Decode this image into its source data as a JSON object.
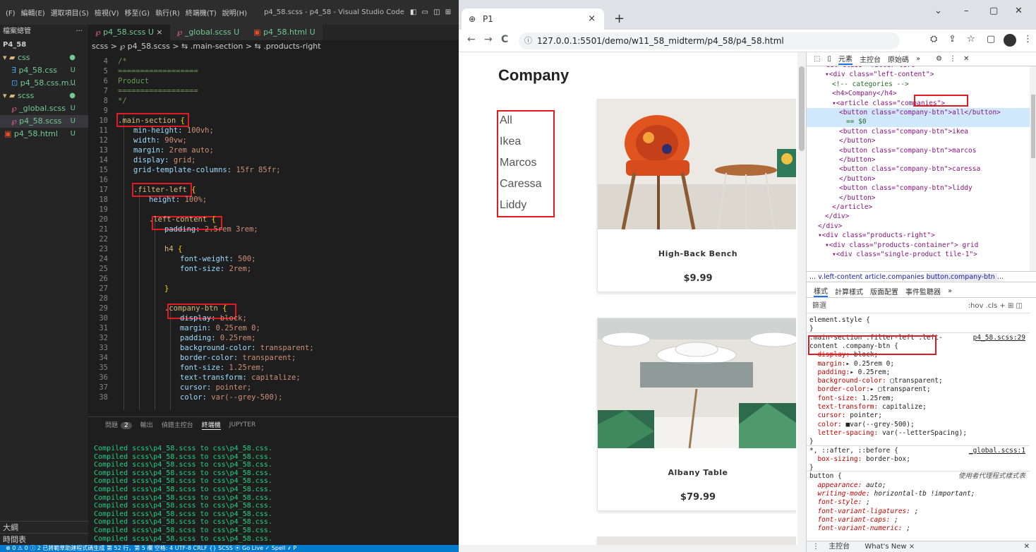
{
  "vscode": {
    "menu": [
      "(F)",
      "編輯(E)",
      "選取項目(S)",
      "檢視(V)",
      "移至(G)",
      "執行(R)",
      "終端機(T)",
      "說明(H)"
    ],
    "title": "p4_58.scss - p4_58 - Visual Studio Code",
    "layout_icons": "◧ ▭ ◫ ⊞",
    "explorer": {
      "header": "檔案總管",
      "dots": "···",
      "root": "P4_58",
      "items": [
        {
          "label": "css",
          "kind": "folder",
          "status": "●"
        },
        {
          "label": "p4_58.css",
          "kind": "css",
          "status": "U"
        },
        {
          "label": "p4_58.css.m...",
          "kind": "map",
          "status": "U"
        },
        {
          "label": "scss",
          "kind": "folder",
          "status": "●"
        },
        {
          "label": "_global.scss",
          "kind": "scss",
          "status": "U"
        },
        {
          "label": "p4_58.scss",
          "kind": "scss",
          "status": "U"
        },
        {
          "label": "p4_58.html",
          "kind": "html",
          "status": "U"
        }
      ],
      "outline": "大綱",
      "timeline": "時間表"
    },
    "tabs": [
      {
        "label": "p4_58.scss U",
        "close": "×"
      },
      {
        "label": "_global.scss U",
        "close": ""
      },
      {
        "label": "p4_58.html U",
        "close": ""
      }
    ],
    "breadcrumb": "scss > ℘ p4_58.scss > ⇆ .main-section > ⇆ .products-right",
    "code_lines": [
      {
        "n": "4",
        "t": "/*",
        "c": "cmt",
        "indent": 1
      },
      {
        "n": "5",
        "t": "==================",
        "c": "cmt",
        "indent": 1
      },
      {
        "n": "6",
        "t": "Product",
        "c": "cmt",
        "indent": 1
      },
      {
        "n": "7",
        "t": "==================",
        "c": "cmt",
        "indent": 1
      },
      {
        "n": "8",
        "t": "*/",
        "c": "cmt",
        "indent": 1
      },
      {
        "n": "9",
        "t": "",
        "c": "",
        "indent": 0
      },
      {
        "n": "10",
        "t": ".main-section {",
        "c": "sel",
        "indent": 1
      },
      {
        "n": "11",
        "t": "min-height: 100vh;",
        "c": "prop",
        "indent": 2
      },
      {
        "n": "12",
        "t": "width: 90vw;",
        "c": "prop",
        "indent": 2
      },
      {
        "n": "13",
        "t": "margin: 2rem auto;",
        "c": "prop",
        "indent": 2
      },
      {
        "n": "14",
        "t": "display: grid;",
        "c": "prop",
        "indent": 2
      },
      {
        "n": "15",
        "t": "grid-template-columns: 15fr 85fr;",
        "c": "prop",
        "indent": 2
      },
      {
        "n": "16",
        "t": "",
        "c": "",
        "indent": 0
      },
      {
        "n": "17",
        "t": ".filter-left {",
        "c": "sel",
        "indent": 2
      },
      {
        "n": "18",
        "t": "height: 100%;",
        "c": "prop",
        "indent": 3
      },
      {
        "n": "19",
        "t": "",
        "c": "",
        "indent": 0
      },
      {
        "n": "20",
        "t": ".left-content {",
        "c": "sel",
        "indent": 3
      },
      {
        "n": "21",
        "t": "padding: 2.5rem 3rem;",
        "c": "prop",
        "indent": 4
      },
      {
        "n": "22",
        "t": "",
        "c": "",
        "indent": 0
      },
      {
        "n": "23",
        "t": "h4 {",
        "c": "sel",
        "indent": 4
      },
      {
        "n": "24",
        "t": "font-weight: 500;",
        "c": "prop",
        "indent": 5
      },
      {
        "n": "25",
        "t": "font-size: 2rem;",
        "c": "prop",
        "indent": 5
      },
      {
        "n": "26",
        "t": "",
        "c": "",
        "indent": 0
      },
      {
        "n": "27",
        "t": "}",
        "c": "brc",
        "indent": 4
      },
      {
        "n": "28",
        "t": "",
        "c": "",
        "indent": 0
      },
      {
        "n": "29",
        "t": ".company-btn {",
        "c": "sel",
        "indent": 4
      },
      {
        "n": "30",
        "t": "display: block;",
        "c": "prop",
        "indent": 5
      },
      {
        "n": "31",
        "t": "margin: 0.25rem 0;",
        "c": "prop",
        "indent": 5
      },
      {
        "n": "32",
        "t": "padding: 0.25rem;",
        "c": "prop",
        "indent": 5
      },
      {
        "n": "33",
        "t": "background-color: transparent;",
        "c": "prop",
        "indent": 5
      },
      {
        "n": "34",
        "t": "border-color: transparent;",
        "c": "prop",
        "indent": 5
      },
      {
        "n": "35",
        "t": "font-size: 1.25rem;",
        "c": "prop",
        "indent": 5
      },
      {
        "n": "36",
        "t": "text-transform: capitalize;",
        "c": "prop",
        "indent": 5
      },
      {
        "n": "37",
        "t": "cursor: pointer;",
        "c": "prop",
        "indent": 5
      },
      {
        "n": "38",
        "t": "color: var(--grey-500);",
        "c": "prop",
        "indent": 5
      }
    ],
    "panel_tabs": {
      "problems": "問題",
      "problems_count": "2",
      "output": "輸出",
      "debug": "偵錯主控台",
      "terminal": "終端機",
      "jupyter": "JUPYTER"
    },
    "terminal_lines": [
      "Compiled scss\\p4_58.scss to css\\p4_58.css.",
      "Compiled scss\\p4_58.scss to css\\p4_58.css.",
      "Compiled scss\\p4_58.scss to css\\p4_58.css.",
      "Compiled scss\\p4_58.scss to css\\p4_58.css.",
      "Compiled scss\\p4_58.scss to css\\p4_58.css.",
      "Compiled scss\\p4_58.scss to css\\p4_58.css.",
      "Compiled scss\\p4_58.scss to css\\p4_58.css.",
      "Compiled scss\\p4_58.scss to css\\p4_58.css.",
      "Compiled scss\\p4_58.scss to css\\p4_58.css.",
      "Compiled scss\\p4_58.scss to css\\p4_58.css.",
      "Compiled scss\\p4_58.scss to css\\p4_58.css.",
      "Compiled scss\\p4_58.scss to css\\p4_58.css."
    ],
    "statusbar": "⊗ 0 ⚠ 0 ⓘ 2        已將範草助建程式碼生成   第 52 行，第 5 欄   空格: 4   UTF-8   CRLF   {} SCSS   ⦿ Go Live   ✓ Spell   ⸙ P"
  },
  "chrome": {
    "tab_title": "P1",
    "tab_close": "×",
    "new_tab": "+",
    "window_controls": [
      "⌄",
      "–",
      "▢",
      "✕"
    ],
    "url": "127.0.0.1:5501/demo/w11_58_midterm/p4_58/p4_58.html",
    "nav": {
      "back": "←",
      "forward": "→",
      "reload": "C",
      "info": "ⓘ"
    },
    "toolbar_icons": {
      "translate": "⛭",
      "share": "⇪",
      "star": "☆",
      "sidebar": "▢",
      "menu": "⋮"
    }
  },
  "page": {
    "heading": "Company",
    "companies": [
      "All",
      "Ikea",
      "Marcos",
      "Caressa",
      "Liddy"
    ],
    "products": [
      {
        "name": "High-Back Bench",
        "price": "$9.99"
      },
      {
        "name": "Albany Table",
        "price": "$79.99"
      }
    ]
  },
  "devtools": {
    "tabs": [
      "元素",
      "主控台",
      "原始碼",
      "»"
    ],
    "dom_lines": [
      {
        "t": "▾<div class=\"filter-left\">",
        "indent": 2,
        "hl": false
      },
      {
        "t": "▾<div class=\"left-content\">",
        "indent": 3,
        "hl": false
      },
      {
        "t": "<!-- categories -->",
        "indent": 4,
        "hl": false,
        "cm": true
      },
      {
        "t": "<h4>Company</h4>",
        "indent": 4,
        "hl": false
      },
      {
        "t": "▾<article class=\"companies\">",
        "indent": 4,
        "hl": false
      },
      {
        "t": "<button class=\"company-btn\">all</button>",
        "indent": 5,
        "hl": true
      },
      {
        "t": "== $0",
        "indent": 6,
        "hl": true,
        "cm": true
      },
      {
        "t": "<button class=\"company-btn\">ikea",
        "indent": 5,
        "hl": false
      },
      {
        "t": "</button>",
        "indent": 5,
        "hl": false
      },
      {
        "t": "<button class=\"company-btn\">marcos",
        "indent": 5,
        "hl": false
      },
      {
        "t": "</button>",
        "indent": 5,
        "hl": false
      },
      {
        "t": "<button class=\"company-btn\">caressa",
        "indent": 5,
        "hl": false
      },
      {
        "t": "</button>",
        "indent": 5,
        "hl": false
      },
      {
        "t": "<button class=\"company-btn\">liddy",
        "indent": 5,
        "hl": false
      },
      {
        "t": "</button>",
        "indent": 5,
        "hl": false
      },
      {
        "t": "</article>",
        "indent": 4,
        "hl": false
      },
      {
        "t": "</div>",
        "indent": 3,
        "hl": false
      },
      {
        "t": "</div>",
        "indent": 2,
        "hl": false
      },
      {
        "t": "▾<div class=\"products-right\">",
        "indent": 2,
        "hl": false
      },
      {
        "t": "▾<div class=\"products-container\"> grid",
        "indent": 3,
        "hl": false
      },
      {
        "t": "▾<div class=\"single-product tile-1\">",
        "indent": 4,
        "hl": false
      }
    ],
    "breadcrumb": [
      "...",
      "v.left-content",
      "article.companies",
      "button.company-btn",
      "..."
    ],
    "style_tabs": [
      "樣式",
      "計算樣式",
      "版面配置",
      "事件監聽器",
      "»"
    ],
    "filter_label": "篩選",
    "filter_right": ":hov  .cls  +  ⊞  ◫",
    "styles_lines": [
      {
        "t": "element.style {",
        "k": "sel"
      },
      {
        "t": "}",
        "k": "sel"
      },
      {
        "t": ".main-section .filter-left .left-",
        "k": "sel",
        "link": "p4_58.scss:29"
      },
      {
        "t": "content .company-btn {",
        "k": "sel"
      },
      {
        "t": "  display: block;",
        "k": "decl"
      },
      {
        "t": "  margin:▸ 0.25rem 0;",
        "k": "decl"
      },
      {
        "t": "  padding:▸ 0.25rem;",
        "k": "decl"
      },
      {
        "t": "  background-color: ▢transparent;",
        "k": "decl"
      },
      {
        "t": "  border-color:▸ ▢transparent;",
        "k": "decl"
      },
      {
        "t": "  font-size: 1.25rem;",
        "k": "decl"
      },
      {
        "t": "  text-transform: capitalize;",
        "k": "decl"
      },
      {
        "t": "  cursor: pointer;",
        "k": "decl"
      },
      {
        "t": "  color: ■var(--grey-500);",
        "k": "decl"
      },
      {
        "t": "  letter-spacing: var(--letterSpacing);",
        "k": "decl"
      },
      {
        "t": "}",
        "k": "sel"
      },
      {
        "t": "*, ::after, ::before {",
        "k": "sel",
        "link": "_global.scss:1"
      },
      {
        "t": "  box-sizing: border-box;",
        "k": "decl"
      },
      {
        "t": "}",
        "k": "sel"
      },
      {
        "t": "button {",
        "k": "sel",
        "link": "使用者代理程式樣式表"
      },
      {
        "t": "  appearance: auto;",
        "k": "ua"
      },
      {
        "t": "  writing-mode: horizontal-tb !important;",
        "k": "ua"
      },
      {
        "t": "  font-style: ;",
        "k": "ua"
      },
      {
        "t": "  font-variant-ligatures: ;",
        "k": "ua"
      },
      {
        "t": "  font-variant-caps: ;",
        "k": "ua"
      },
      {
        "t": "  font-variant-numeric: ;",
        "k": "ua"
      }
    ],
    "drawer": {
      "console": "主控台",
      "whats_new": "What's New ×",
      "close": "✕"
    }
  }
}
